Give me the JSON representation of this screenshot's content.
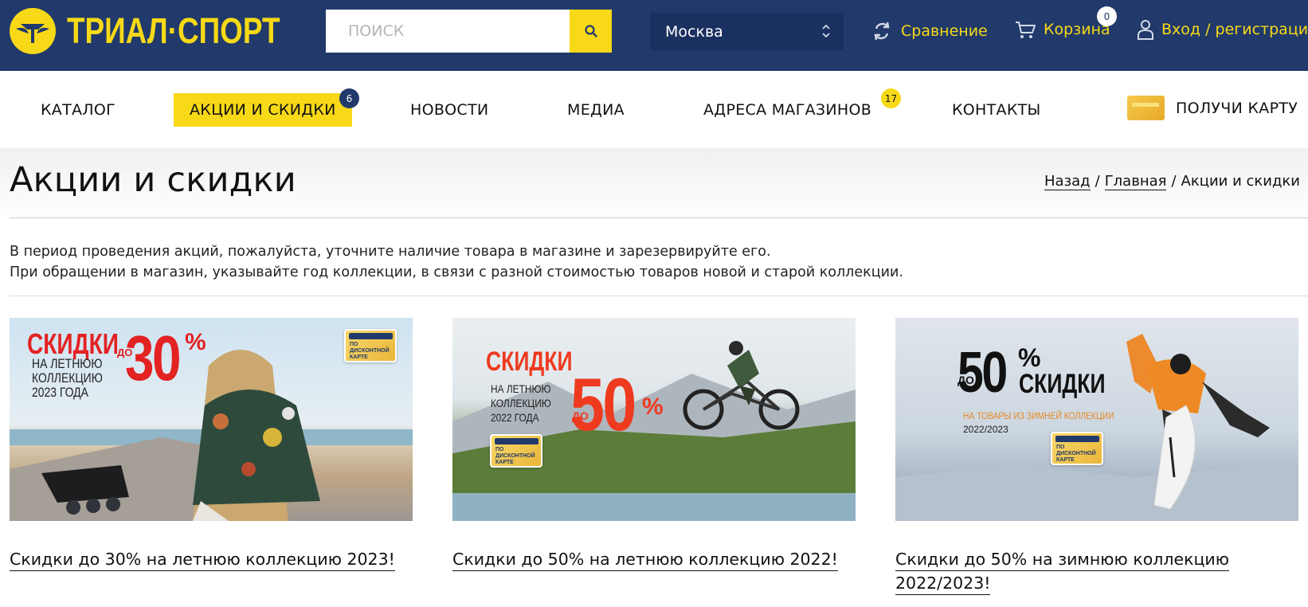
{
  "brand": {
    "name": "ТРИАЛ·СПОРТ",
    "accent": "#f7d917",
    "primary": "#213a6b"
  },
  "header": {
    "search_placeholder": "ПОИСК",
    "city": "Москва",
    "compare_label": "Сравнение",
    "cart_label": "Корзина",
    "cart_count": "0",
    "login_label": "Вход / регистрация"
  },
  "nav": {
    "catalog": "КАТАЛОГ",
    "promotions": "АКЦИИ И СКИДКИ",
    "promotions_badge": "6",
    "news": "НОВОСТИ",
    "media": "МЕДИА",
    "stores": "АДРЕСА МАГАЗИНОВ",
    "stores_badge": "17",
    "contacts": "КОНТАКТЫ",
    "get_card": "ПОЛУЧИ КАРТУ"
  },
  "page": {
    "title": "Акции и скидки",
    "breadcrumbs": {
      "back": "Назад",
      "home": "Главная",
      "current": "Акции и скидки"
    },
    "intro_line1": "В период проведения акций, пожалуйста, уточните наличие товара в магазине и зарезервируйте его.",
    "intro_line2": "При обращении в магазин, указывайте год коллекции, в связи с разной стоимостью товаров новой и старой коллекции."
  },
  "promos": [
    {
      "caption": "Скидки до 30% на летнюю коллекцию 2023!",
      "banner": {
        "headline": "СКИДКИ",
        "sub1": "НА ЛЕТНЮЮ",
        "sub2": "КОЛЛЕКЦИЮ",
        "sub3": "2023 ГОДА",
        "upto": "ДО",
        "percent": "30",
        "pct": "%",
        "card1": "ПО",
        "card2": "ДИСКОНТНОЙ",
        "card3": "КАРТЕ"
      }
    },
    {
      "caption": "Скидки до 50% на летнюю коллекцию 2022!",
      "banner": {
        "headline": "СКИДКИ",
        "sub1": "НА ЛЕТНЮЮ",
        "sub2": "КОЛЛЕКЦИЮ",
        "sub3": "2022 ГОДА",
        "upto": "ДО",
        "percent": "50",
        "pct": "%",
        "card1": "ПО",
        "card2": "ДИСКОНТНОЙ",
        "card3": "КАРТЕ"
      }
    },
    {
      "caption": "Скидки до 50% на зимнюю коллекцию 2022/2023!",
      "banner": {
        "upto": "ДО",
        "percent": "50",
        "pct": "%",
        "headline": "СКИДКИ",
        "sub1": "НА ТОВАРЫ ИЗ ЗИМНЕЙ КОЛЛЕКЦИИ",
        "sub2": "2022/2023",
        "card1": "ПО",
        "card2": "ДИСКОНТНОЙ",
        "card3": "КАРТЕ"
      }
    }
  ]
}
